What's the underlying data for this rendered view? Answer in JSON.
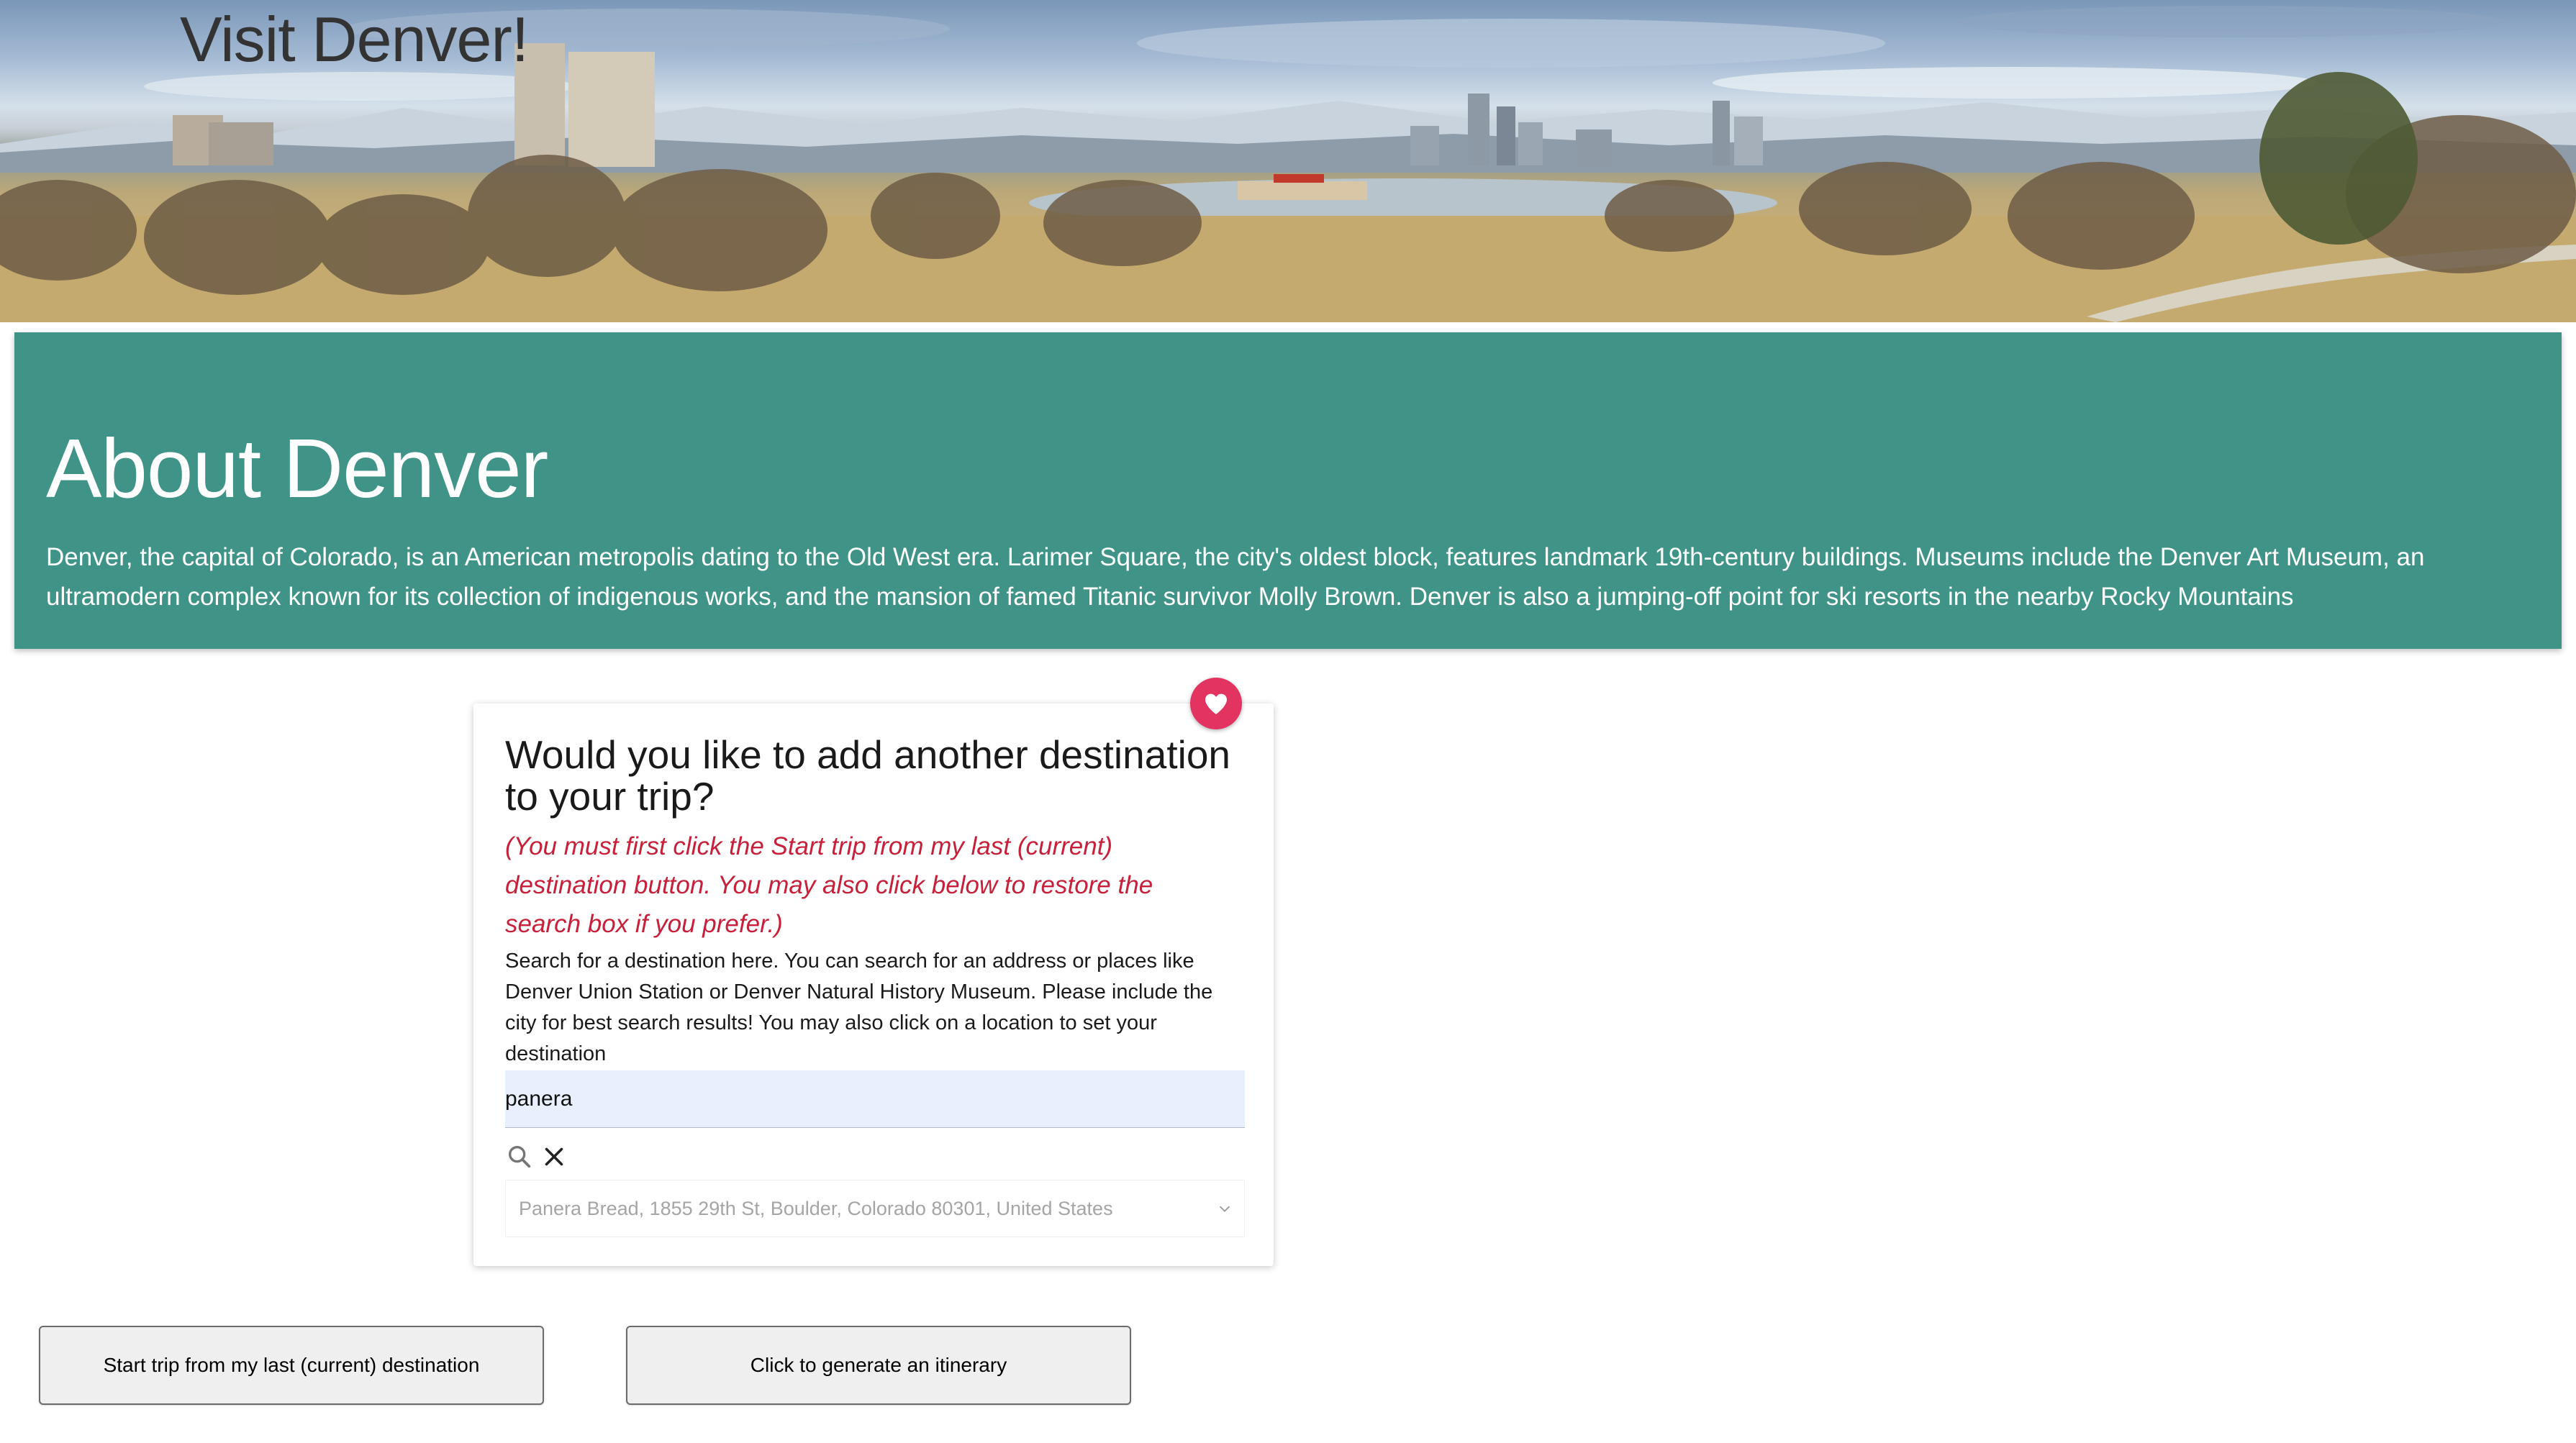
{
  "header": {
    "title": "Visit Denver!",
    "banner_image": "denver-city-park-skyline-panorama"
  },
  "about": {
    "heading": "About Denver",
    "description": "Denver, the capital of Colorado, is an American metropolis dating to the Old West era. Larimer Square, the city's oldest block, features landmark 19th-century buildings. Museums include the Denver Art Museum, an ultramodern complex known for its collection of indigenous works, and the mansion of famed Titanic survivor Molly Brown. Denver is also a jumping-off point for ski resorts in the nearby Rocky Mountains",
    "background_color": "#409487"
  },
  "destination_card": {
    "favorite_icon": "heart-icon",
    "title": "Would you like to add another destination to your trip?",
    "warning": "(You must first click the Start trip from my last (current) destination button. You may also click below to restore the search box if you prefer.)",
    "instructions": "Search for a destination here. You can search for an address or places like Denver Union Station or Denver Natural History Museum. Please include the city for best search results! You may also click on a location to set your destination",
    "search": {
      "value": "panera",
      "search_icon": "search-icon",
      "clear_icon": "close-icon"
    },
    "result": {
      "selected": "Panera Bread, 1855 29th St, Boulder, Colorado 80301, United States",
      "icon": "chevron-down-icon"
    }
  },
  "actions": {
    "start_trip_label": "Start trip from my last (current) destination",
    "itinerary_label": "Click to generate an itinerary"
  },
  "colors": {
    "accent_teal": "#409487",
    "favorite_pink": "#e33360",
    "warning_red": "#c8203a"
  }
}
